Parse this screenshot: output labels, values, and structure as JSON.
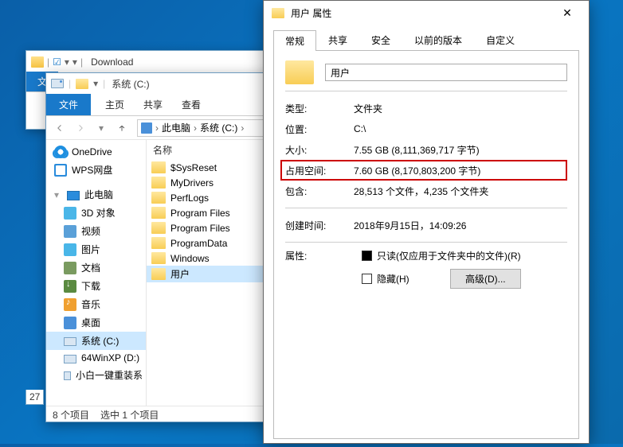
{
  "download_window": {
    "title": "Download"
  },
  "explorer_window": {
    "title": "系统 (C:)",
    "ribbon": {
      "file": "文件",
      "home": "主页",
      "share": "共享",
      "view": "查看"
    },
    "breadcrumb": {
      "pc": "此电脑",
      "drive": "系统 (C:)"
    },
    "nav": {
      "onedrive": "OneDrive",
      "wps": "WPS网盘",
      "pc": "此电脑",
      "three_d": "3D 对象",
      "video": "视频",
      "pictures": "图片",
      "documents": "文档",
      "downloads": "下载",
      "music": "音乐",
      "desktop": "桌面",
      "c_drive": "系统 (C:)",
      "d_drive": "64WinXP  (D:)",
      "e_drive": "小白一键重装系"
    },
    "col_name": "名称",
    "files": {
      "f0": "$SysReset",
      "f1": "MyDrivers",
      "f2": "PerfLogs",
      "f3": "Program Files",
      "f4": "Program Files",
      "f5": "ProgramData",
      "f6": "Windows",
      "f7": "用户"
    },
    "status": {
      "count": "8 个项目",
      "selected": "选中 1 个项目"
    },
    "left_count": "27"
  },
  "properties_dialog": {
    "title": "用户 属性",
    "tabs": {
      "general": "常规",
      "share": "共享",
      "security": "安全",
      "prev": "以前的版本",
      "custom": "自定义"
    },
    "folder_name": "用户",
    "rows": {
      "type_k": "类型:",
      "type_v": "文件夹",
      "loc_k": "位置:",
      "loc_v": "C:\\",
      "size_k": "大小:",
      "size_v": "7.55 GB (8,111,369,717 字节)",
      "disk_k": "占用空间:",
      "disk_v": "7.60 GB (8,170,803,200 字节)",
      "contains_k": "包含:",
      "contains_v": "28,513 个文件，4,235 个文件夹",
      "created_k": "创建时间:",
      "created_v": "2018年9月15日，14:09:26",
      "attr_k": "属性:"
    },
    "attrs": {
      "readonly": "只读(仅应用于文件夹中的文件)(R)",
      "hidden": "隐藏(H)",
      "advanced": "高级(D)..."
    }
  }
}
